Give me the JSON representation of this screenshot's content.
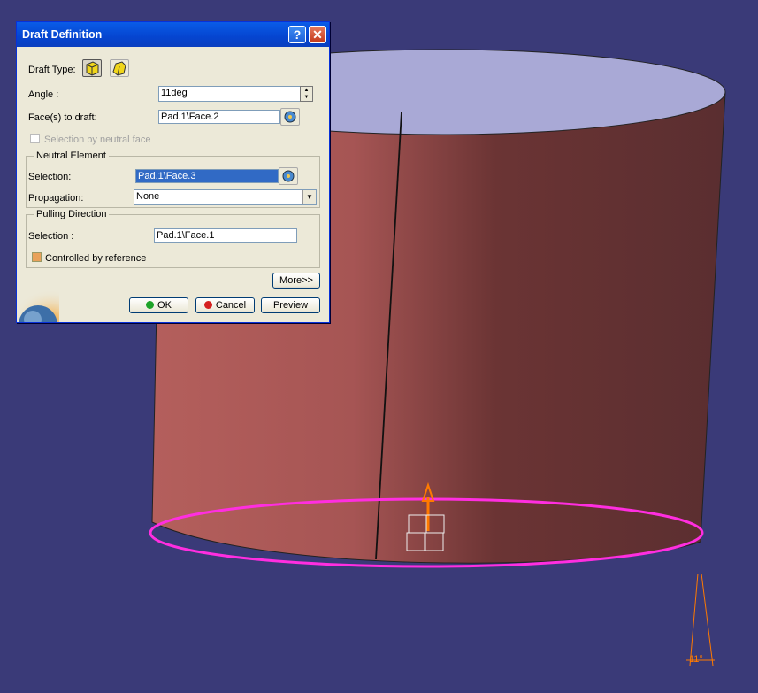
{
  "dialog": {
    "title": "Draft Definition",
    "help_glyph": "?",
    "close_glyph": "✕",
    "draft_type_label": "Draft Type:",
    "angle_label": "Angle :",
    "angle_value": "11deg",
    "faces_label": "Face(s) to draft:",
    "faces_value": "Pad.1\\Face.2",
    "neutral_face_checkbox_label": "Selection by neutral face",
    "neutral_element": {
      "group_title": "Neutral Element",
      "selection_label": "Selection:",
      "selection_value": "Pad.1\\Face.3",
      "propagation_label": "Propagation:",
      "propagation_value": "None"
    },
    "pulling_direction": {
      "group_title": "Pulling Direction",
      "selection_label": "Selection :",
      "selection_value": "Pad.1\\Face.1",
      "controlled_label": "Controlled by reference"
    },
    "more_label": "More>>",
    "ok_label": "OK",
    "cancel_label": "Cancel",
    "preview_label": "Preview"
  },
  "viewport": {
    "angle_annotation": "11°"
  },
  "colors": {
    "background": "#3a3a78",
    "cylinder_left": "#b45f5c",
    "cylinder_right": "#5c2f30",
    "top_face": "#a9a9d6",
    "neutral_curve": "#ff2ee0",
    "pulling_arrow": "#ff7a00"
  }
}
